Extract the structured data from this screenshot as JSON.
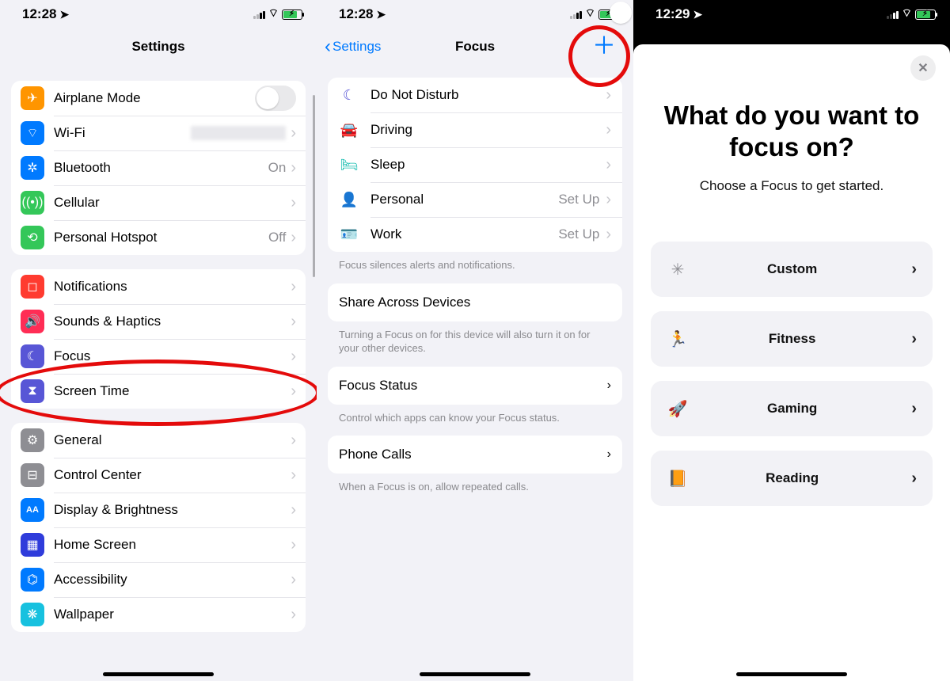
{
  "status": {
    "time1": "12:28",
    "time2": "12:28",
    "time3": "12:29"
  },
  "panel1": {
    "title": "Settings",
    "groupA": [
      {
        "icon": "✈︎",
        "bg": "#ff9500",
        "label": "Airplane Mode",
        "accessory": "toggle-off"
      },
      {
        "icon": "⌔",
        "bg": "#007aff",
        "label": "Wi-Fi",
        "accessory": "blur-chev"
      },
      {
        "icon": "✲",
        "bg": "#007aff",
        "label": "Bluetooth",
        "detail": "On",
        "accessory": "chev"
      },
      {
        "icon": "((•))",
        "bg": "#34c759",
        "label": "Cellular",
        "accessory": "chev"
      },
      {
        "icon": "⟲",
        "bg": "#34c759",
        "label": "Personal Hotspot",
        "detail": "Off",
        "accessory": "chev"
      }
    ],
    "groupB": [
      {
        "icon": "◻︎",
        "bg": "#ff3b30",
        "label": "Notifications",
        "accessory": "chev"
      },
      {
        "icon": "🔊",
        "bg": "#ff2d55",
        "label": "Sounds & Haptics",
        "accessory": "chev"
      },
      {
        "icon": "☾",
        "bg": "#5856d6",
        "label": "Focus",
        "accessory": "chev"
      },
      {
        "icon": "⧗",
        "bg": "#5856d6",
        "label": "Screen Time",
        "accessory": "chev"
      }
    ],
    "groupC": [
      {
        "icon": "⚙︎",
        "bg": "#8e8e93",
        "label": "General",
        "accessory": "chev"
      },
      {
        "icon": "⊟",
        "bg": "#8e8e93",
        "label": "Control Center",
        "accessory": "chev"
      },
      {
        "icon": "AA",
        "bg": "#007aff",
        "label": "Display & Brightness",
        "accessory": "chev"
      },
      {
        "icon": "▦",
        "bg": "#2f3cdb",
        "label": "Home Screen",
        "accessory": "chev"
      },
      {
        "icon": "⌬",
        "bg": "#007aff",
        "label": "Accessibility",
        "accessory": "chev"
      },
      {
        "icon": "❋",
        "bg": "#17c1df",
        "label": "Wallpaper",
        "accessory": "chev"
      }
    ]
  },
  "panel2": {
    "back": "Settings",
    "title": "Focus",
    "modes": [
      {
        "icon": "☾",
        "color": "#5856d6",
        "label": "Do Not Disturb"
      },
      {
        "icon": "🚘",
        "color": "#3a57c8",
        "label": "Driving"
      },
      {
        "icon": "🛏",
        "color": "#17bdb0",
        "label": "Sleep"
      },
      {
        "icon": "👤",
        "color": "#a855d8",
        "label": "Personal",
        "detail": "Set Up"
      },
      {
        "icon": "🪪",
        "color": "#2aa3e8",
        "label": "Work",
        "detail": "Set Up"
      }
    ],
    "footer1": "Focus silences alerts and notifications.",
    "share": {
      "label": "Share Across Devices"
    },
    "footer2": "Turning a Focus on for this device will also turn it on for your other devices.",
    "status": {
      "label": "Focus Status"
    },
    "footer3": "Control which apps can know your Focus status.",
    "phone": {
      "label": "Phone Calls"
    },
    "footer4": "When a Focus is on, allow repeated calls."
  },
  "panel3": {
    "title": "What do you want to focus on?",
    "subtitle": "Choose a Focus to get started.",
    "options": [
      {
        "icon": "✳︎",
        "color": "#8e8e93",
        "label": "Custom"
      },
      {
        "icon": "🏃",
        "color": "#34c759",
        "label": "Fitness"
      },
      {
        "icon": "🚀",
        "color": "#0a84ff",
        "label": "Gaming"
      },
      {
        "icon": "📙",
        "color": "#ff9500",
        "label": "Reading"
      }
    ]
  }
}
